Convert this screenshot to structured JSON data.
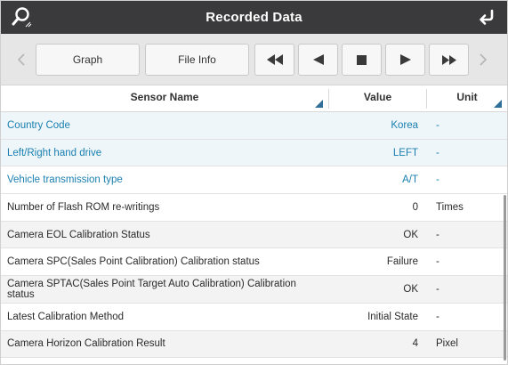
{
  "header": {
    "title": "Recorded Data"
  },
  "toolbar": {
    "graph_label": "Graph",
    "file_info_label": "File Info"
  },
  "table": {
    "columns": [
      "Sensor Name",
      "Value",
      "Unit"
    ],
    "rows": [
      {
        "name": "Country Code",
        "value": "Korea",
        "unit": "-"
      },
      {
        "name": "Left/Right hand drive",
        "value": "LEFT",
        "unit": "-"
      },
      {
        "name": "Vehicle transmission type",
        "value": "A/T",
        "unit": "-"
      },
      {
        "name": "Number of Flash ROM re-writings",
        "value": "0",
        "unit": "Times"
      },
      {
        "name": "Camera EOL Calibration Status",
        "value": "OK",
        "unit": "-"
      },
      {
        "name": "Camera SPC(Sales Point Calibration) Calibration status",
        "value": "Failure",
        "unit": "-"
      },
      {
        "name": "Camera SPTAC(Sales Point Target Auto Calibration) Calibration status",
        "value": "OK",
        "unit": "-"
      },
      {
        "name": "Latest Calibration Method",
        "value": "Initial State",
        "unit": "-"
      },
      {
        "name": "Camera Horizon Calibration Result",
        "value": "4",
        "unit": "Pixel"
      }
    ]
  },
  "icons": {
    "search": "search-icon",
    "back": "back-arrow-icon",
    "rewind": "rewind-icon",
    "step_back": "step-back-icon",
    "stop": "stop-icon",
    "play": "play-icon",
    "fast_forward": "fast-forward-icon",
    "scroll_left": "chevron-left-icon",
    "scroll_right": "chevron-right-icon"
  },
  "colors": {
    "titlebar": "#3a3a3c",
    "link_text": "#1a7fb0",
    "row_highlight": "#eef6f9",
    "row_grey": "#f3f3f3"
  }
}
